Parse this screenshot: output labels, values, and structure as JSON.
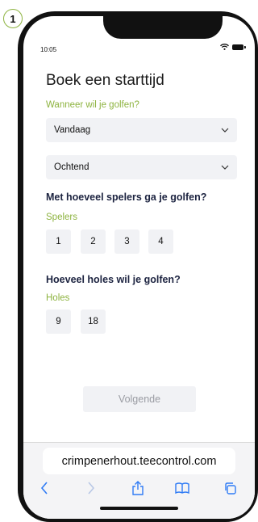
{
  "step": "1",
  "status_bar": {
    "time": "10:05"
  },
  "page": {
    "title": "Boek een starttijd",
    "when_label": "Wanneer wil je golfen?",
    "day_select": "Vandaag",
    "daypart_select": "Ochtend",
    "players_question": "Met hoeveel spelers ga je golfen?",
    "players_label": "Spelers",
    "players_options": [
      "1",
      "2",
      "3",
      "4"
    ],
    "holes_question": "Hoeveel holes wil je golfen?",
    "holes_label": "Holes",
    "holes_options": [
      "9",
      "18"
    ],
    "next_button": "Volgende"
  },
  "browser": {
    "url": "crimpenerhout.teecontrol.com",
    "toolbar_icons": [
      "back-icon",
      "forward-icon",
      "share-icon",
      "bookmarks-icon",
      "tabs-icon"
    ]
  },
  "colors": {
    "accent": "#8db33f",
    "heading": "#1c2340",
    "control_bg": "#f1f2f5",
    "ios_blue": "#2f7bf5"
  }
}
